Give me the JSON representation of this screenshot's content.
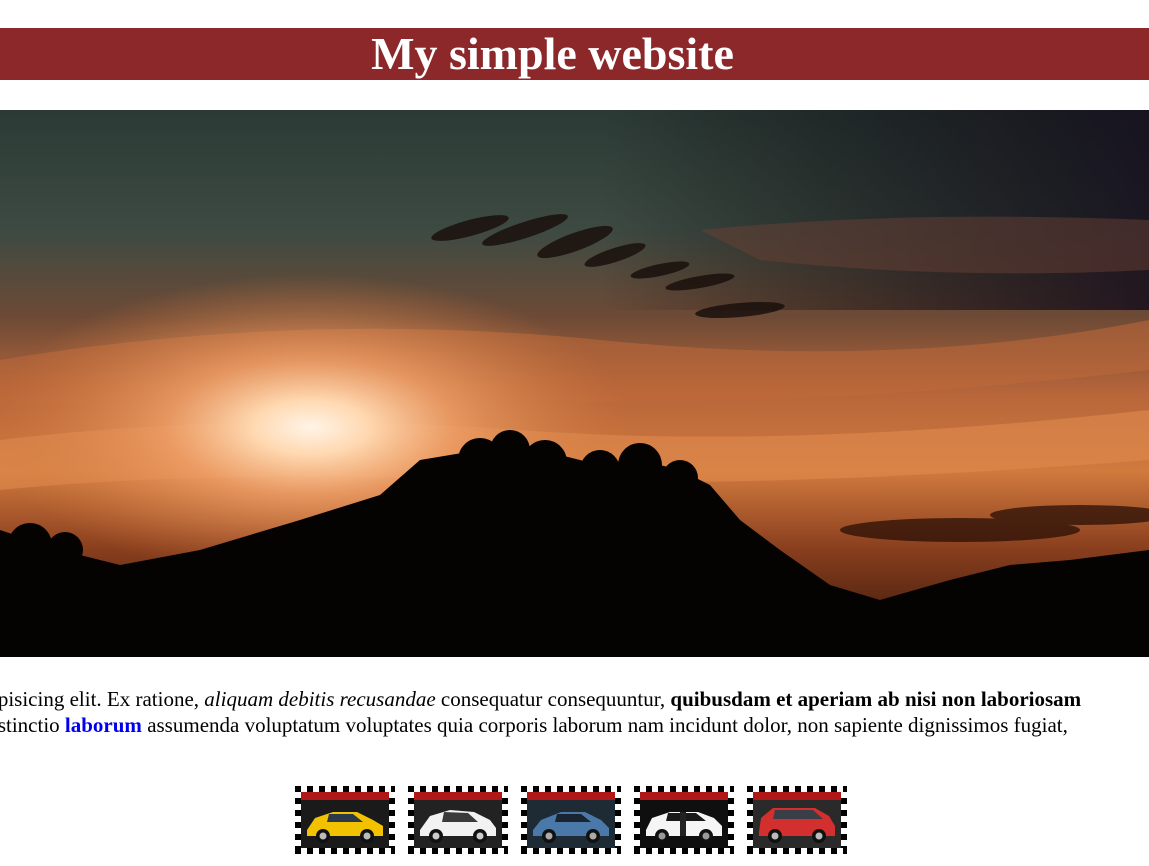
{
  "header": {
    "title": "My simple website",
    "background_color": "#8d282a",
    "text_color": "#ffffff"
  },
  "hero": {
    "image": "sunset-silhouette-hills-photo"
  },
  "body_text": {
    "line1": {
      "part1": "ipisicing elit. Ex ratione, ",
      "italic": "aliquam debitis recusandae",
      "part2": " consequatur consequuntur, ",
      "bold": "quibusdam et aperiam ab nisi non laboriosam"
    },
    "line2": {
      "part1": "istinctio ",
      "link": "laborum",
      "part2": " assumenda voluptatum voluptates quia corporis laborum nam incidunt dolor, non sapiente dignissimos fugiat,"
    },
    "link_color": "#0000ee"
  },
  "gallery": {
    "thumbnails": [
      {
        "icon": "yellow-car-thumbnail",
        "car_color": "#f2c200",
        "bg": "#1a1a1a"
      },
      {
        "icon": "white-car-thumbnail",
        "car_color": "#f2f2f2",
        "bg": "#222222"
      },
      {
        "icon": "blue-car-thumbnail",
        "car_color": "#4a78a8",
        "bg": "#1e2a34"
      },
      {
        "icon": "black-white-car-thumbnail",
        "car_color": "#f5f5f5",
        "bg": "#0f0f0f"
      },
      {
        "icon": "red-suv-thumbnail",
        "car_color": "#d32f2f",
        "bg": "#2a2a2a"
      }
    ]
  }
}
